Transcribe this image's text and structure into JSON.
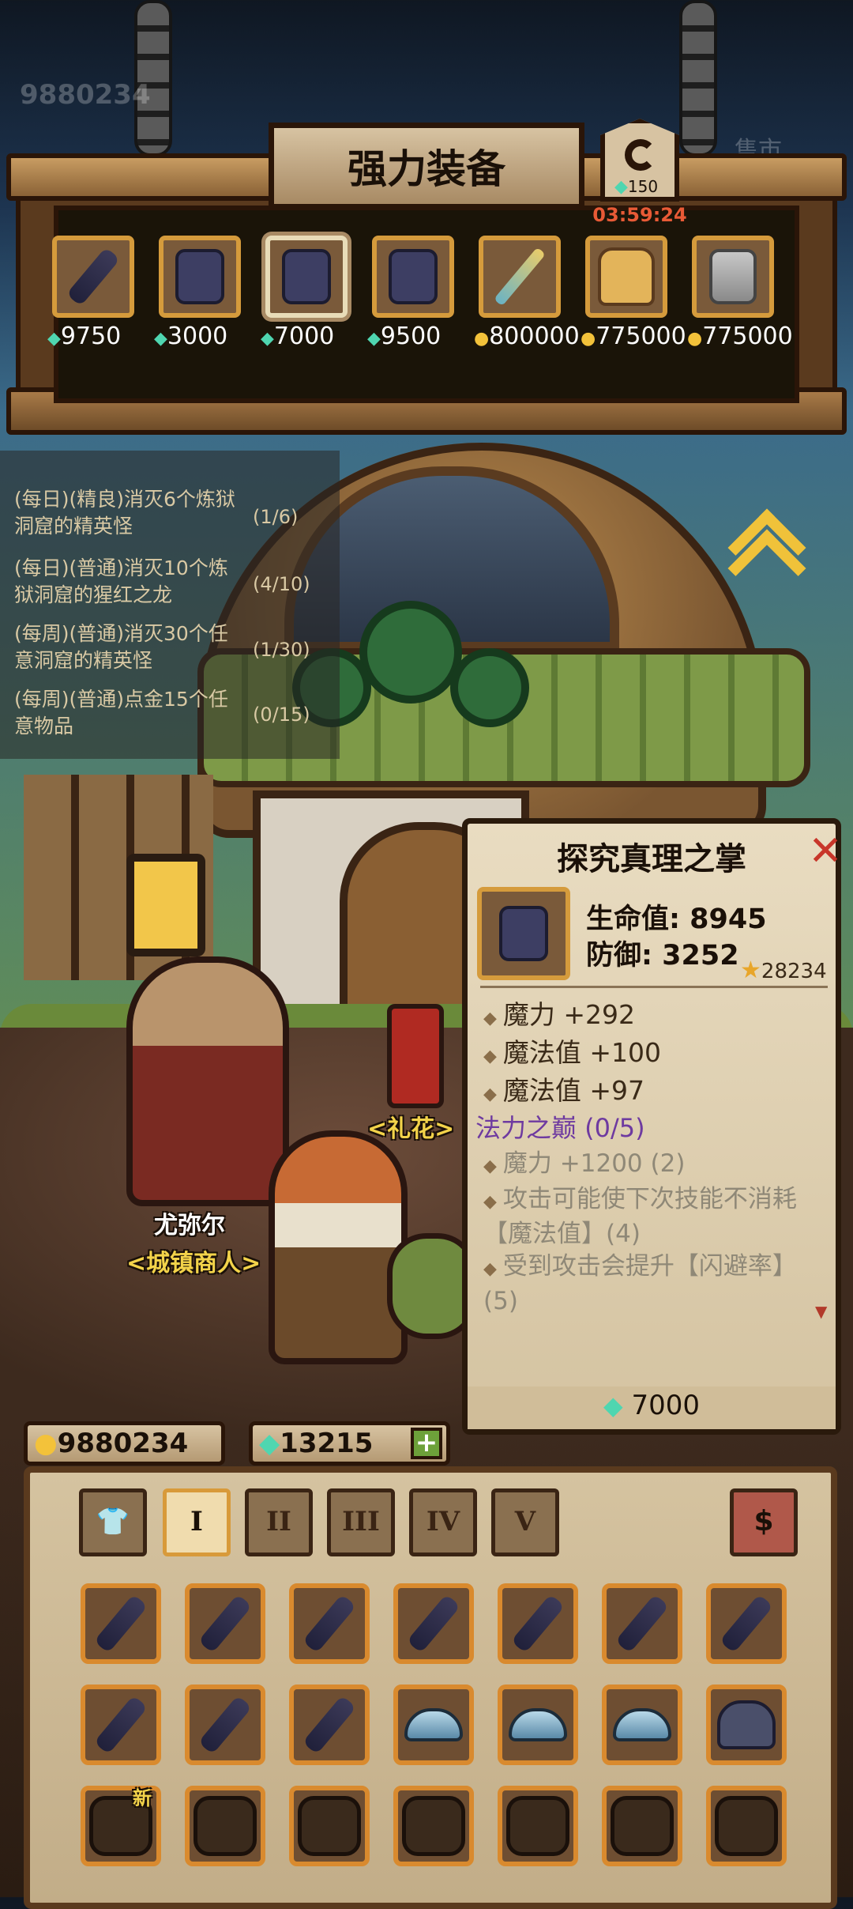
{
  "top_gold_ghost": "9880234",
  "top_right_ghost": "售市",
  "shop": {
    "title": "强力装备",
    "refresh_cost": "150",
    "refresh_timer": "03:59:24",
    "items": [
      {
        "name": "claw-weapon",
        "price": "9750",
        "currency": "gem",
        "art": "claw"
      },
      {
        "name": "gauntlet-blue",
        "price": "3000",
        "currency": "gem",
        "art": "gauntlet"
      },
      {
        "name": "gauntlet-dark",
        "price": "7000",
        "currency": "gem",
        "art": "gauntlet",
        "selected": true
      },
      {
        "name": "gauntlet-red",
        "price": "9500",
        "currency": "gem",
        "art": "gauntlet"
      },
      {
        "name": "dagger",
        "price": "800000",
        "currency": "gold",
        "art": "dagger"
      },
      {
        "name": "armor",
        "price": "775000",
        "currency": "gold",
        "art": "armor"
      },
      {
        "name": "steel-glove",
        "price": "775000",
        "currency": "gold",
        "art": "glove"
      }
    ]
  },
  "quests": [
    {
      "text": "(每日)(精良)消灭6个炼狱洞窟的精英怪",
      "progress": "(1/6)"
    },
    {
      "text": "(每日)(普通)消灭10个炼狱洞窟的猩红之龙",
      "progress": "(4/10)"
    },
    {
      "text": "(每周)(普通)消灭30个任意洞窟的精英怪",
      "progress": "(1/30)"
    },
    {
      "text": "(每周)(普通)点金15个任意物品",
      "progress": "(0/15)"
    }
  ],
  "npc": {
    "name": "尤弥尔",
    "title": "<城镇商人>"
  },
  "firework_label": "<礼花>",
  "detail": {
    "title": "探究真理之掌",
    "hp_label": "生命值: 8945",
    "def_label": "防御: 3252",
    "score": "28234",
    "attrs": [
      "魔力 +292",
      "魔法值 +100",
      "魔法值 +97"
    ],
    "set_title": "法力之巅 (0/5)",
    "set_attrs": [
      "魔力 +1200 (2)",
      "攻击可能使下次技能不消耗【魔法值】(4)",
      "受到攻击会提升【闪避率】(5)"
    ],
    "price": "7000"
  },
  "currency": {
    "gold": "9880234",
    "gems": "13215"
  },
  "inventory": {
    "tabs": [
      "I",
      "II",
      "III",
      "IV",
      "V"
    ],
    "active_tab": "I",
    "new_label": "新",
    "rows": [
      [
        "claw",
        "claw",
        "claw",
        "claw",
        "claw",
        "claw",
        "claw"
      ],
      [
        "claw",
        "claw",
        "claw",
        "wing",
        "wing",
        "wing",
        "helm"
      ],
      [
        "chest",
        "chest",
        "chest",
        "chest",
        "chest",
        "chest",
        "chest"
      ]
    ]
  },
  "colors": {
    "accent_gold": "#f3d34a",
    "gem": "#4fd6b0",
    "timer": "#e85a36",
    "set_purple": "#6e3aa0"
  }
}
